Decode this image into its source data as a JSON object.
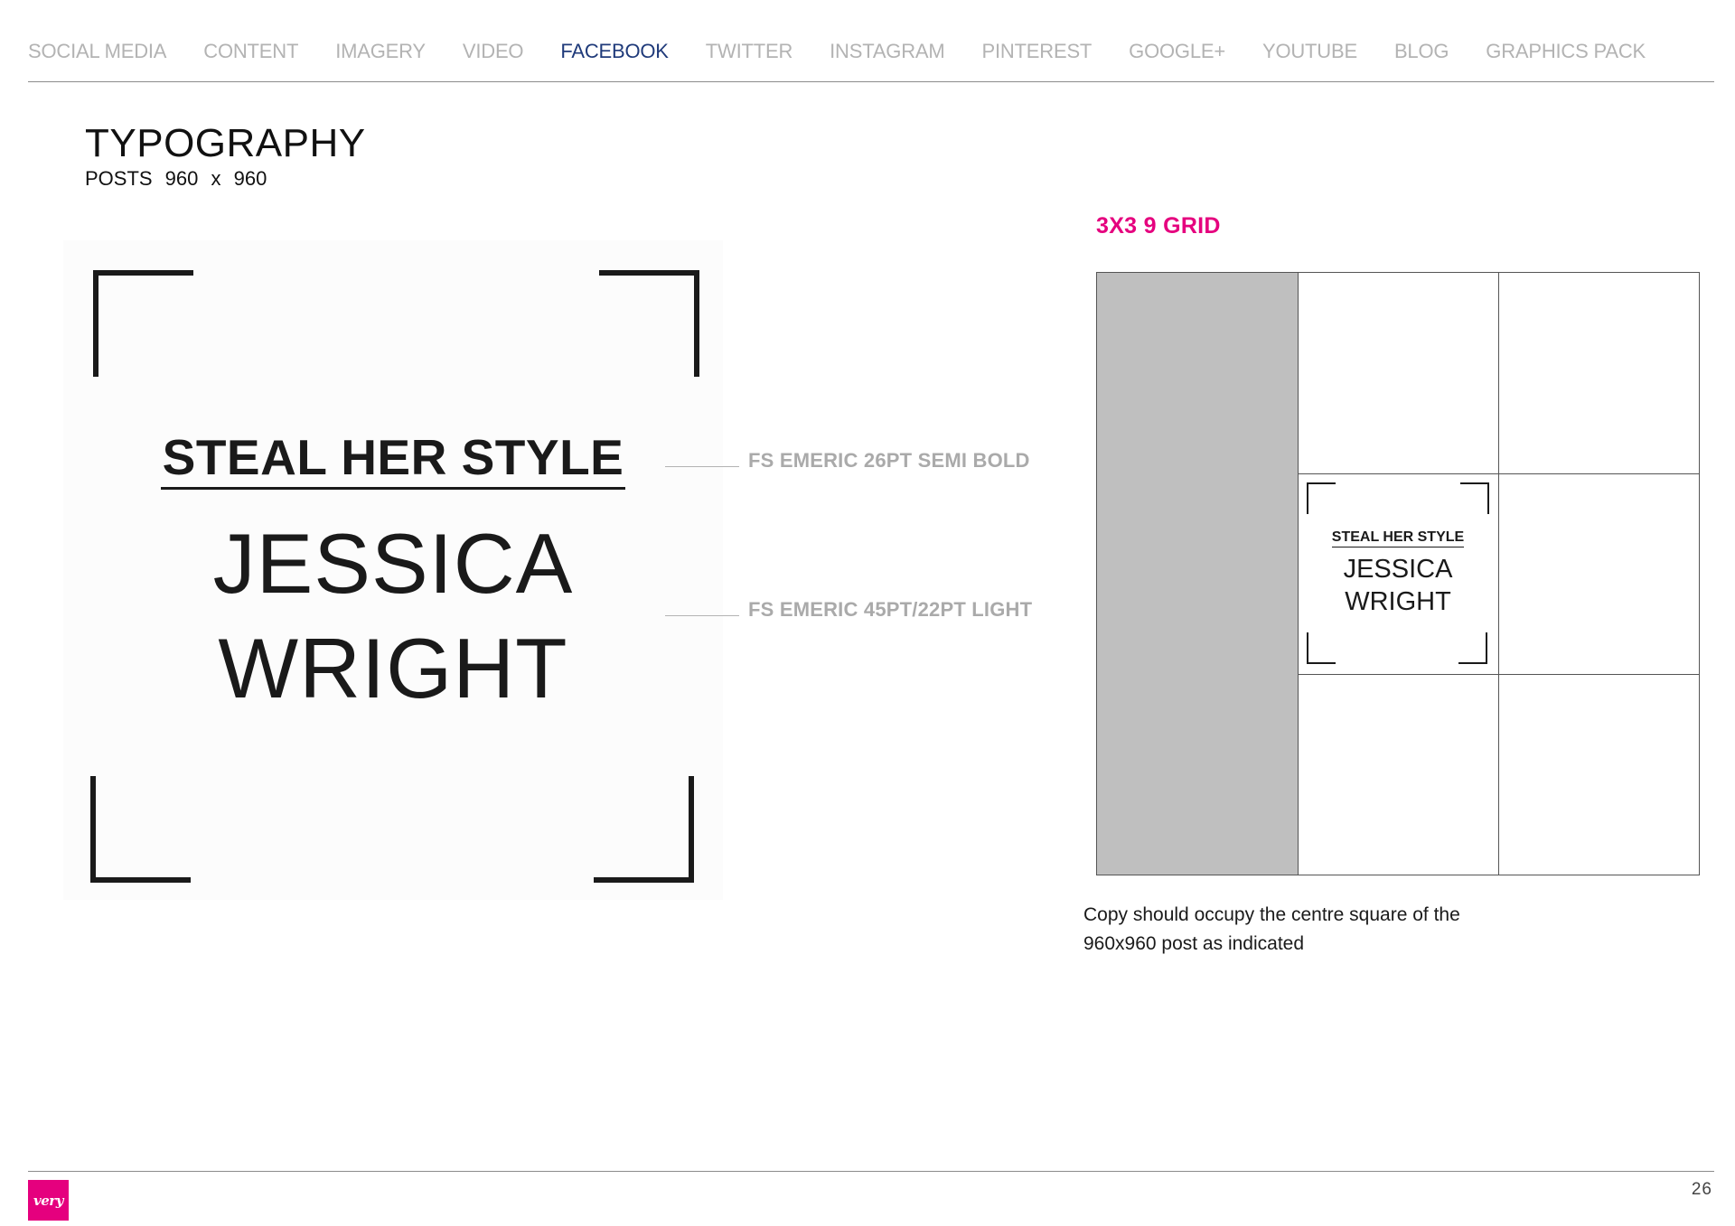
{
  "nav": {
    "items": [
      {
        "label": "SOCIAL MEDIA",
        "active": false
      },
      {
        "label": "CONTENT",
        "active": false
      },
      {
        "label": "IMAGERY",
        "active": false
      },
      {
        "label": "VIDEO",
        "active": false
      },
      {
        "label": "FACEBOOK",
        "active": true
      },
      {
        "label": "TWITTER",
        "active": false
      },
      {
        "label": "INSTAGRAM",
        "active": false
      },
      {
        "label": "PINTEREST",
        "active": false
      },
      {
        "label": "GOOGLE+",
        "active": false
      },
      {
        "label": "YOUTUBE",
        "active": false
      },
      {
        "label": "BLOG",
        "active": false
      },
      {
        "label": "GRAPHICS PACK",
        "active": false
      }
    ],
    "active_color": "#1f3a7a",
    "inactive_color": "#b3b3b3"
  },
  "header": {
    "title": "TYPOGRAPHY",
    "subtitle": "POSTS  960 x 960"
  },
  "post_sample": {
    "heading": "STEAL HER STYLE",
    "name_line1": "JESSICA",
    "name_line2": "WRIGHT"
  },
  "annotations": {
    "heading_spec": "FS EMERIC 26PT SEMI BOLD",
    "name_spec": "FS EMERIC 45PT/22PT LIGHT"
  },
  "grid": {
    "title": "3X3 9 GRID",
    "title_color": "#e5007e",
    "mini_heading": "STEAL HER STYLE",
    "mini_name_line1": "JESSICA",
    "mini_name_line2": "WRIGHT",
    "caption": "Copy should occupy the centre square of the 960x960 post as indicated"
  },
  "footer": {
    "logo_text": "very",
    "logo_color": "#e5007e",
    "page_number": "26"
  }
}
